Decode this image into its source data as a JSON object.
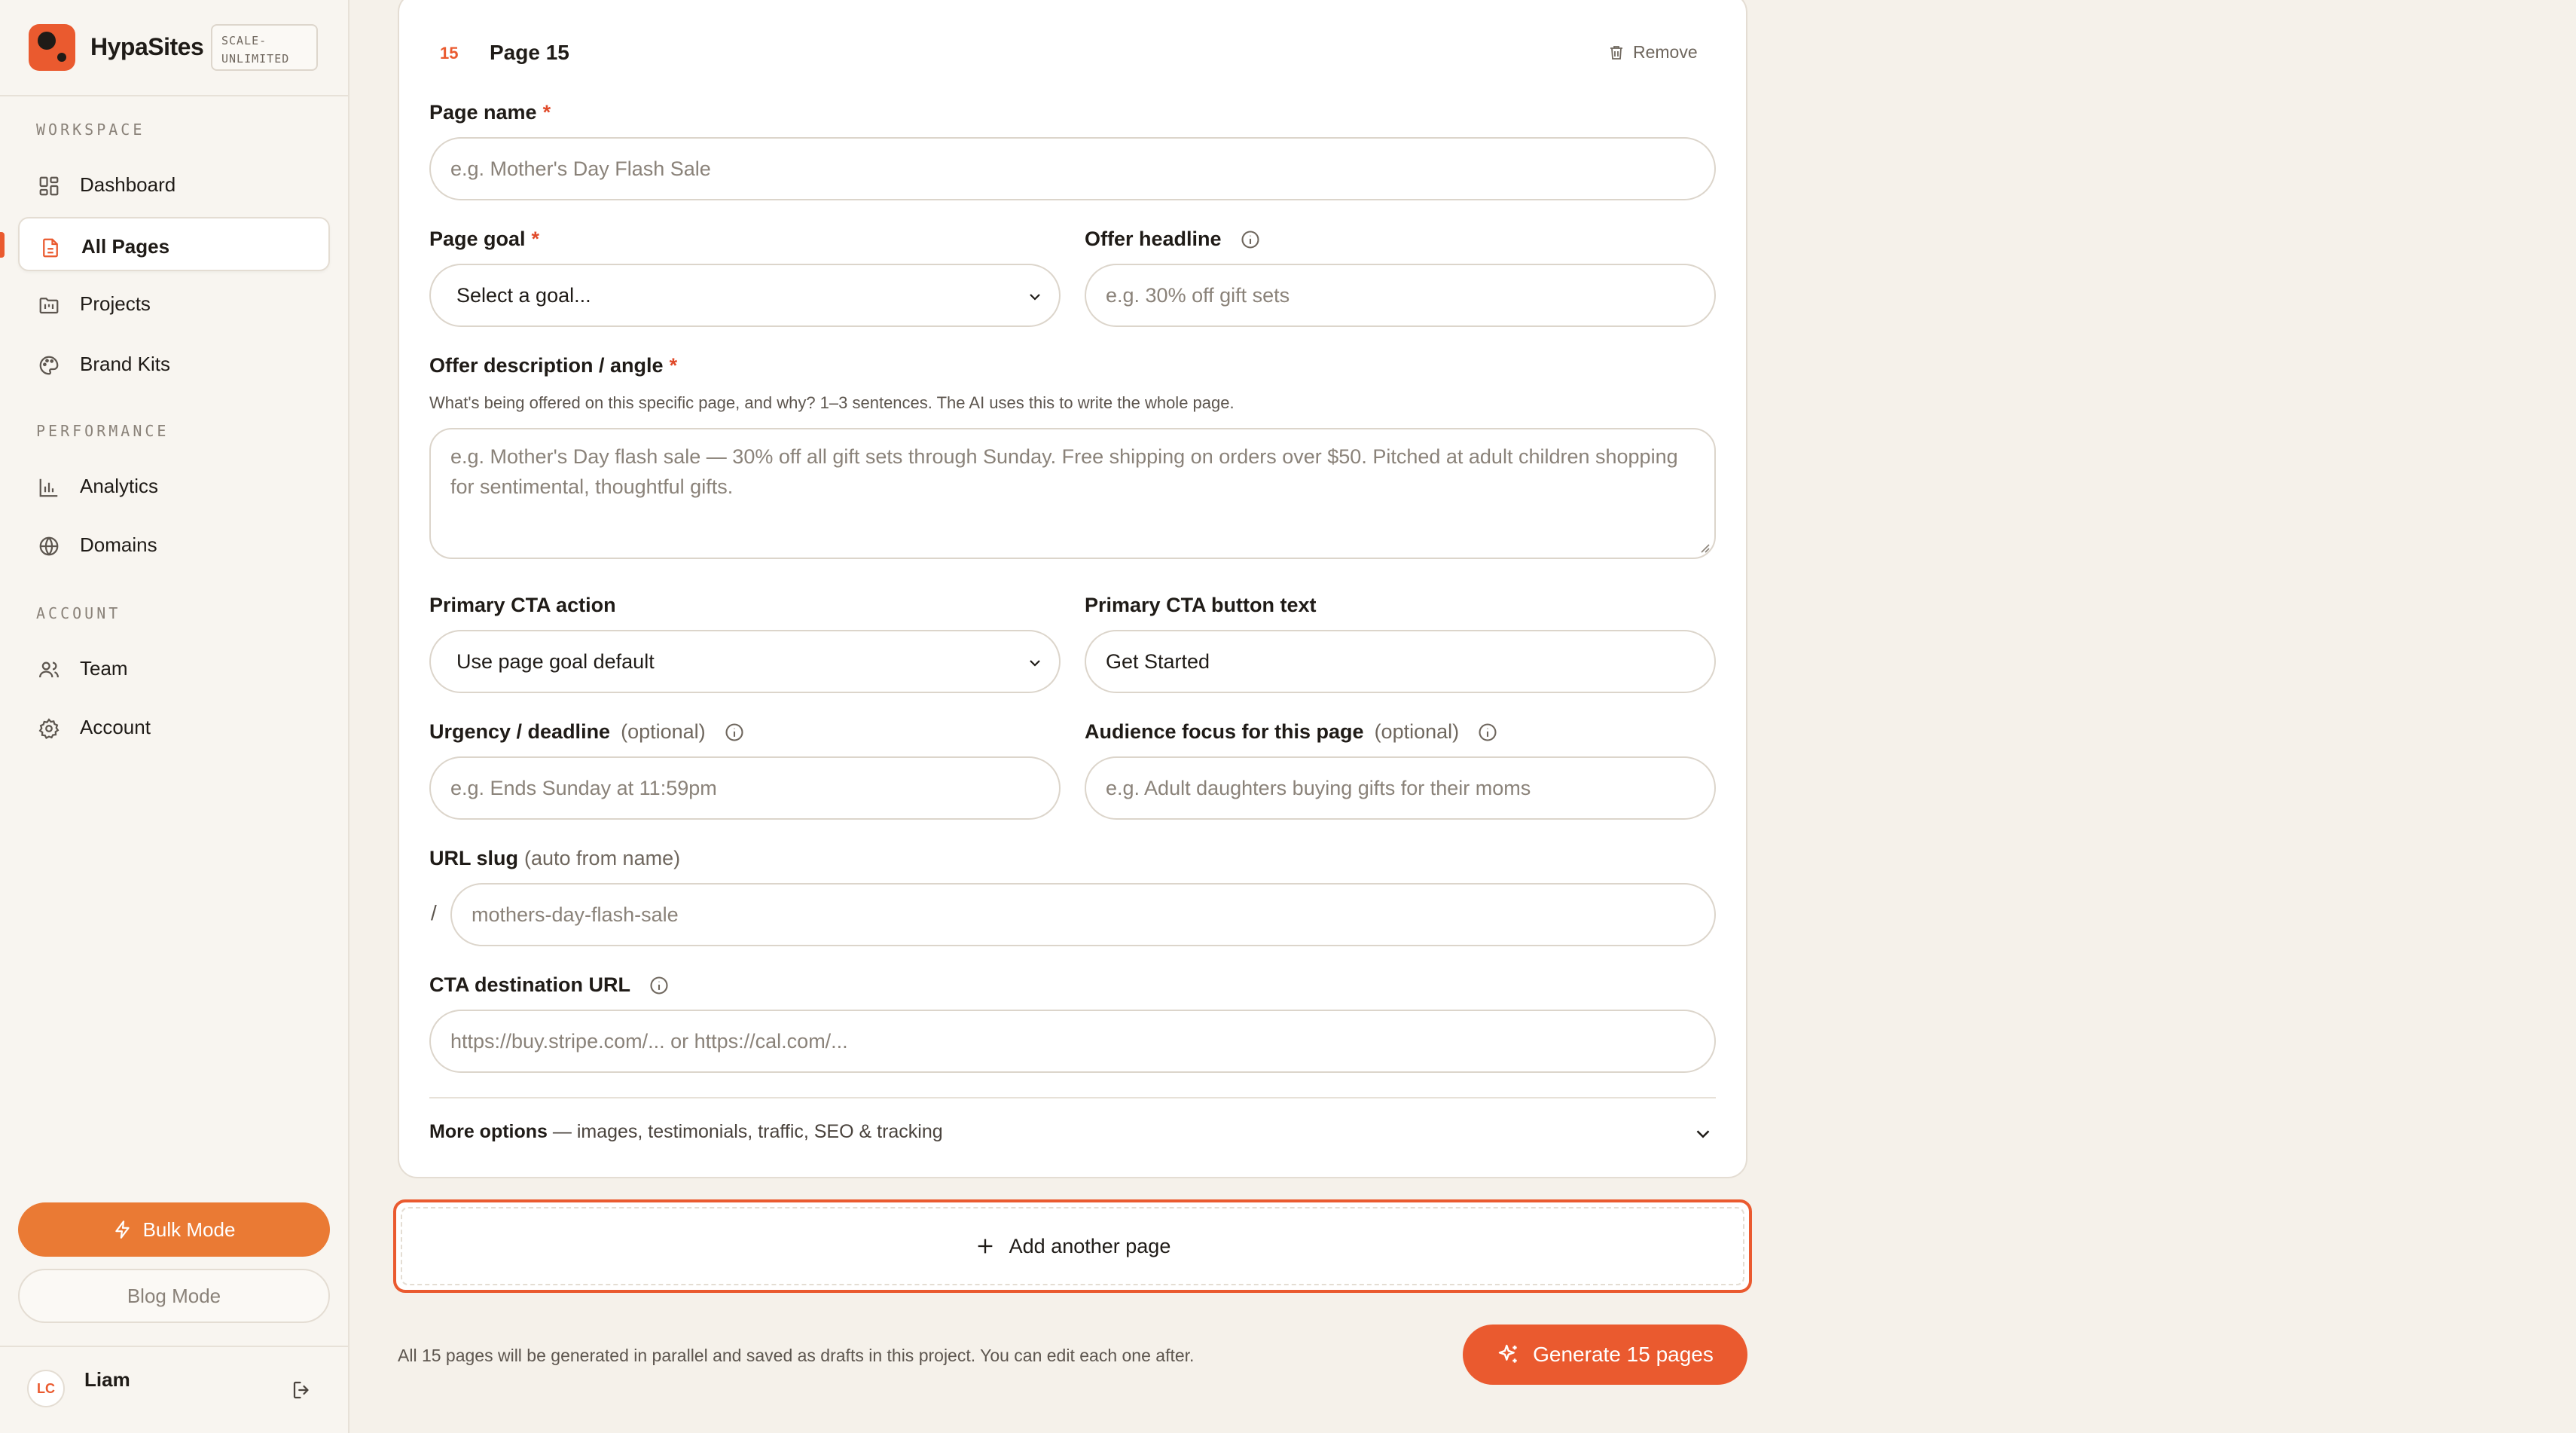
{
  "brand": {
    "name": "HypaSites",
    "plan_line1": "SCALE-",
    "plan_line2": "UNLIMITED"
  },
  "sidebar": {
    "sections": [
      {
        "label": "WORKSPACE",
        "items": [
          {
            "label": "Dashboard",
            "icon": "dashboard-icon"
          },
          {
            "label": "All Pages",
            "icon": "page-icon",
            "active": true
          },
          {
            "label": "Projects",
            "icon": "folder-icon"
          },
          {
            "label": "Brand Kits",
            "icon": "palette-icon"
          }
        ]
      },
      {
        "label": "PERFORMANCE",
        "items": [
          {
            "label": "Analytics",
            "icon": "bar-chart-icon"
          },
          {
            "label": "Domains",
            "icon": "globe-icon"
          }
        ]
      },
      {
        "label": "ACCOUNT",
        "items": [
          {
            "label": "Team",
            "icon": "users-icon"
          },
          {
            "label": "Account",
            "icon": "gear-icon"
          }
        ]
      }
    ],
    "bulk_mode": "Bulk Mode",
    "blog_mode": "Blog Mode",
    "user": {
      "initials": "LC",
      "name": "Liam"
    }
  },
  "page_card": {
    "number": "15",
    "title": "Page 15",
    "remove": "Remove",
    "fields": {
      "page_name": {
        "label": "Page name",
        "placeholder": "e.g. Mother's Day Flash Sale"
      },
      "page_goal": {
        "label": "Page goal",
        "value": "Select a goal..."
      },
      "offer_headline": {
        "label": "Offer headline",
        "placeholder": "e.g. 30% off gift sets"
      },
      "offer_description": {
        "label": "Offer description / angle",
        "helper": "What's being offered on this specific page, and why? 1–3 sentences. The AI uses this to write the whole page.",
        "placeholder": "e.g. Mother's Day flash sale — 30% off all gift sets through Sunday. Free shipping on orders over $50. Pitched at adult children shopping for sentimental, thoughtful gifts."
      },
      "cta_action": {
        "label": "Primary CTA action",
        "value": "Use page goal default"
      },
      "cta_text": {
        "label": "Primary CTA button text",
        "value": "Get Started"
      },
      "urgency": {
        "label": "Urgency / deadline",
        "optional": "(optional)",
        "placeholder": "e.g. Ends Sunday at 11:59pm"
      },
      "audience": {
        "label": "Audience focus for this page",
        "optional": "(optional)",
        "placeholder": "e.g. Adult daughters buying gifts for their moms"
      },
      "url_slug": {
        "label": "URL slug",
        "suffix": "(auto from name)",
        "prefix": "/",
        "placeholder": "mothers-day-flash-sale"
      },
      "cta_url": {
        "label": "CTA destination URL",
        "placeholder": "https://buy.stripe.com/... or https://cal.com/..."
      }
    },
    "more_options": {
      "title": "More options",
      "rest": " — images, testimonials, traffic, SEO & tracking"
    }
  },
  "add_page": "Add another page",
  "footer": {
    "note": "All 15 pages will be generated in parallel and saved as drafts in this project. You can edit each one after.",
    "generate": "Generate 15 pages"
  },
  "colors": {
    "accent": "#ea5a2f",
    "bulk": "#ea7a34",
    "background": "#f5f1ea"
  }
}
